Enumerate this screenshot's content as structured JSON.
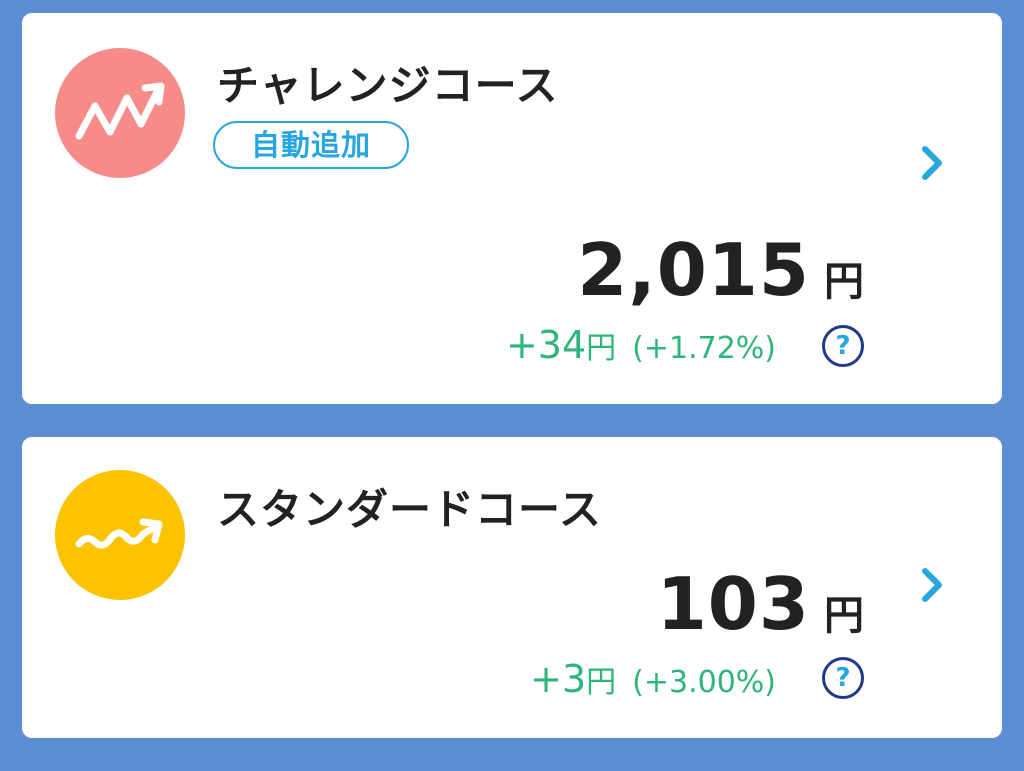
{
  "colors": {
    "background": "#5b8ed3",
    "card": "#ffffff",
    "challenge_icon": "#f68b88",
    "standard_icon": "#fbc302",
    "accent_blue": "#27a6df",
    "gain_green": "#2db57a",
    "help_border": "#1f3a8a"
  },
  "courses": [
    {
      "icon": "zigzag-trend-up-icon",
      "title": "チャレンジコース",
      "badge": "自動追加",
      "amount": "2,015",
      "amount_unit": "円",
      "change": "+34",
      "change_unit": "円",
      "change_pct": "(+1.72%)",
      "help": "?",
      "chevron": "chevron-right-icon"
    },
    {
      "icon": "wave-trend-up-icon",
      "title": "スタンダードコース",
      "amount": "103",
      "amount_unit": "円",
      "change": "+3",
      "change_unit": "円",
      "change_pct": "(+3.00%)",
      "help": "?",
      "chevron": "chevron-right-icon"
    }
  ]
}
